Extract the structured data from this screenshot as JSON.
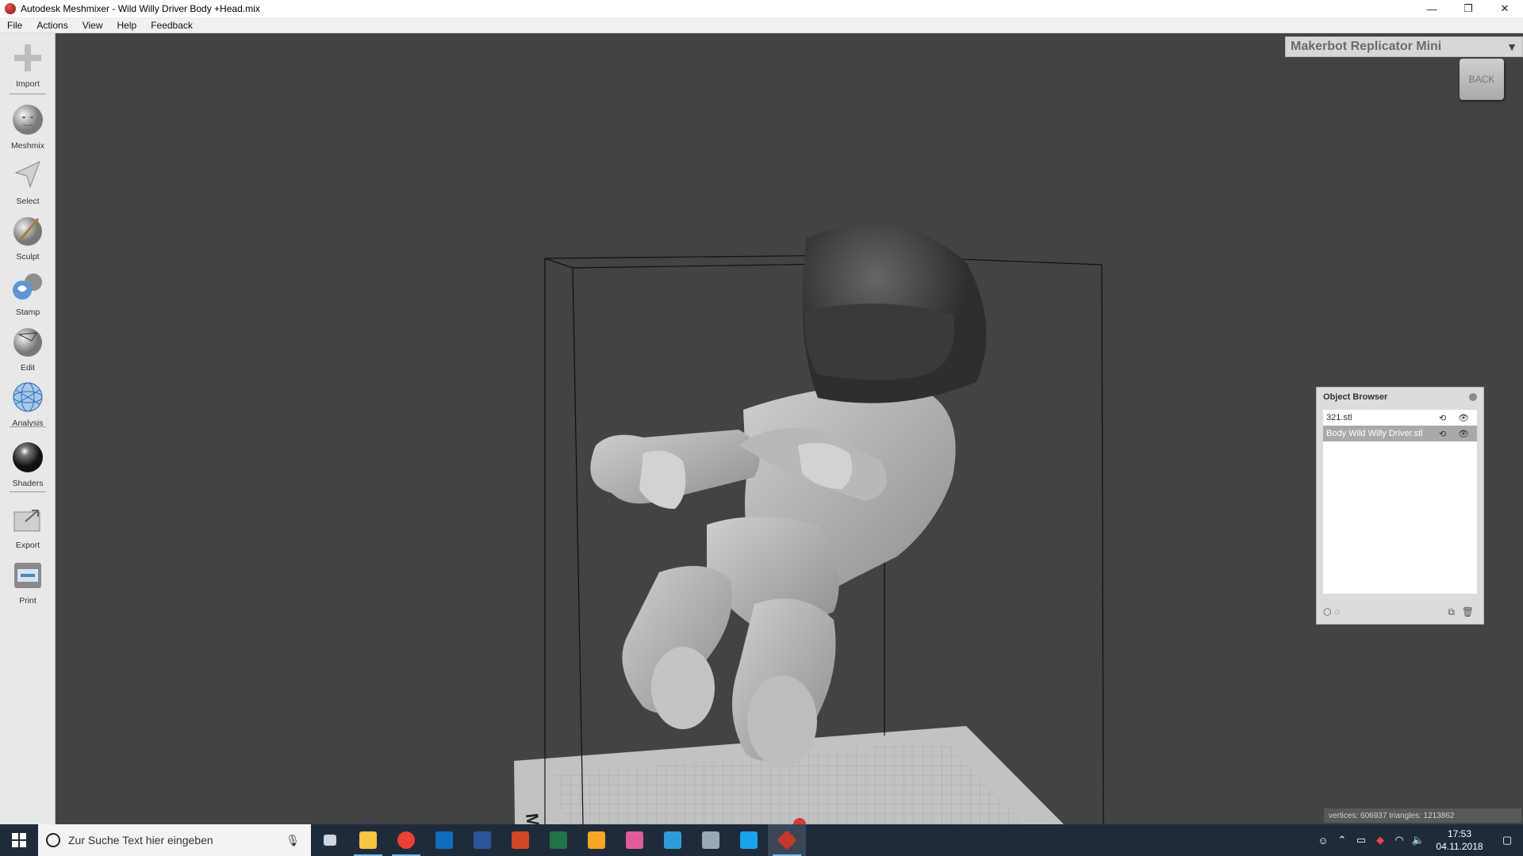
{
  "window": {
    "title": "Autodesk Meshmixer - Wild Willy Driver Body +Head.mix",
    "minimize": "—",
    "restore": "❐",
    "close": "✕"
  },
  "menu": [
    "File",
    "Actions",
    "View",
    "Help",
    "Feedback"
  ],
  "tools": [
    "Import",
    "Meshmix",
    "Select",
    "Sculpt",
    "Stamp",
    "Edit",
    "Analysis",
    "Shaders",
    "Export",
    "Print"
  ],
  "printer": {
    "name": "Makerbot Replicator Mini",
    "arrow": "▼"
  },
  "backcube": "BACK",
  "plate_label": "Makerb",
  "object_browser": {
    "title": "Object Browser",
    "items": [
      {
        "name": "321.stl",
        "selected": false
      },
      {
        "name": "Body Wild Willy Driver.stl",
        "selected": true
      }
    ]
  },
  "status": "vertices: 606937 triangles: 1213862",
  "taskbar": {
    "search_placeholder": "Zur Suche Text hier eingeben",
    "time": "17:53",
    "date": "04.11.2018",
    "apps": [
      {
        "name": "task-view",
        "color": "#cfd6de"
      },
      {
        "name": "file-explorer",
        "color": "#f4c542"
      },
      {
        "name": "chrome",
        "color": "#e94235"
      },
      {
        "name": "outlook",
        "color": "#0f6cbd"
      },
      {
        "name": "word",
        "color": "#2b579a"
      },
      {
        "name": "powerpoint",
        "color": "#d24726"
      },
      {
        "name": "excel",
        "color": "#217346"
      },
      {
        "name": "fusion",
        "color": "#f5a623"
      },
      {
        "name": "paint",
        "color": "#e05b9c"
      },
      {
        "name": "app-blue",
        "color": "#2d9cdb"
      },
      {
        "name": "control-panel",
        "color": "#9aa7b4"
      },
      {
        "name": "ccleaner",
        "color": "#1aa3e8"
      },
      {
        "name": "meshmixer",
        "color": "#c0392b"
      }
    ]
  }
}
